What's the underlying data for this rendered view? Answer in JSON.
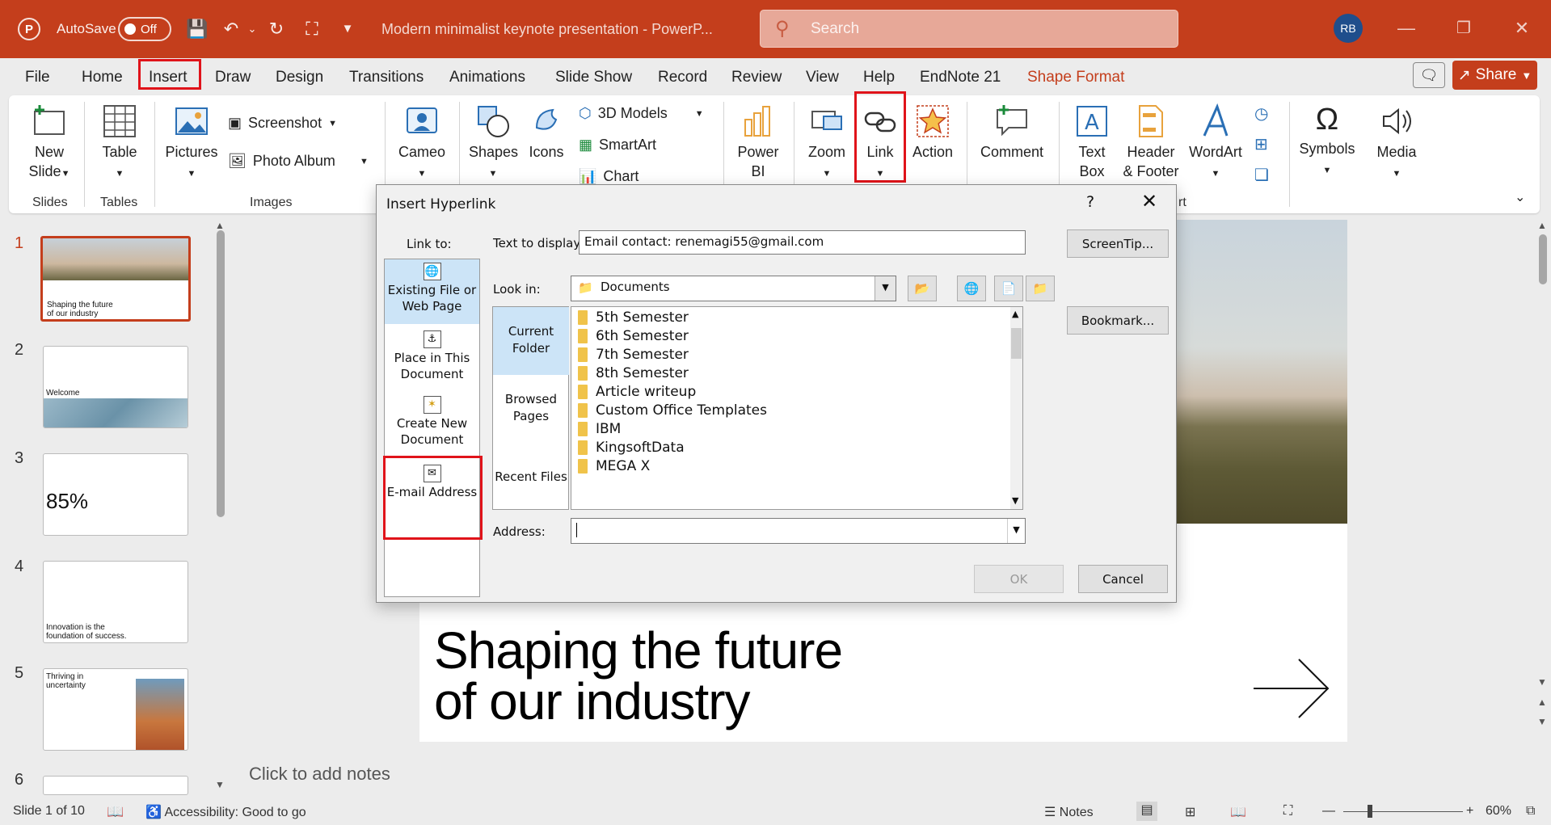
{
  "titlebar": {
    "app_logo": "P",
    "autosave_label": "AutoSave",
    "autosave_state": "Off",
    "document_title": "Modern minimalist keynote presentation  -  PowerP...",
    "search_placeholder": "Search",
    "avatar_initials": "RB"
  },
  "tabs": [
    "File",
    "Home",
    "Insert",
    "Draw",
    "Design",
    "Transitions",
    "Animations",
    "Slide Show",
    "Record",
    "Review",
    "View",
    "Help",
    "EndNote 21",
    "Shape Format"
  ],
  "share_label": "Share",
  "ribbon": {
    "new_slide": "New\nSlide",
    "table": "Table",
    "pictures": "Pictures",
    "screenshot": "Screenshot",
    "photo_album": "Photo Album",
    "cameo": "Cameo",
    "shapes": "Shapes",
    "icons": "Icons",
    "models_3d": "3D Models",
    "smartart": "SmartArt",
    "chart": "Chart",
    "power_bi": "Power\nBI",
    "zoom": "Zoom",
    "link": "Link",
    "action": "Action",
    "comment": "Comment",
    "text_box": "Text\nBox",
    "header_footer": "Header\n& Footer",
    "wordart": "WordArt",
    "symbols": "Symbols",
    "media": "Media",
    "groups": {
      "slides": "Slides",
      "tables": "Tables",
      "images": "Images",
      "text_partial": "rt"
    }
  },
  "thumbnails": [
    {
      "num": "1",
      "caption": "Shaping the future\nof our industry"
    },
    {
      "num": "2",
      "caption": "Welcome"
    },
    {
      "num": "3",
      "caption": "85%"
    },
    {
      "num": "4",
      "caption": "Innovation is the\nfoundation of success."
    },
    {
      "num": "5",
      "caption": "Thriving in\nuncertainty"
    },
    {
      "num": "6",
      "caption": ""
    }
  ],
  "slide": {
    "title": "Shaping the future\nof our industry"
  },
  "notes_placeholder": "Click to add notes",
  "statusbar": {
    "slide_of": "Slide 1 of 10",
    "accessibility": "Accessibility: Good to go",
    "notes": "Notes",
    "zoom": "60%"
  },
  "dialog": {
    "title": "Insert Hyperlink",
    "help": "?",
    "link_to_label": "Link to:",
    "link_to_options": [
      {
        "label": "Existing File or\nWeb Page"
      },
      {
        "label": "Place in This\nDocument"
      },
      {
        "label": "Create New\nDocument"
      },
      {
        "label": "E-mail Address"
      }
    ],
    "text_to_display_label": "Text to display:",
    "text_to_display_value": "Email contact: renemagi55@gmail.com",
    "screentip": "ScreenTip...",
    "look_in_label": "Look in:",
    "look_in_value": "Documents",
    "browse_options": [
      "Current\nFolder",
      "Browsed\nPages",
      "Recent Files"
    ],
    "files": [
      "5th Semester",
      "6th Semester",
      "7th Semester",
      "8th Semester",
      "Article writeup",
      "Custom Office Templates",
      "IBM",
      "KingsoftData",
      "MEGA X"
    ],
    "bookmark": "Bookmark...",
    "address_label": "Address:",
    "address_value": "",
    "ok": "OK",
    "cancel": "Cancel"
  },
  "colors": {
    "accent": "#c43e1c",
    "highlight_box": "#e0131a",
    "selected_bg": "#cce4f7"
  }
}
